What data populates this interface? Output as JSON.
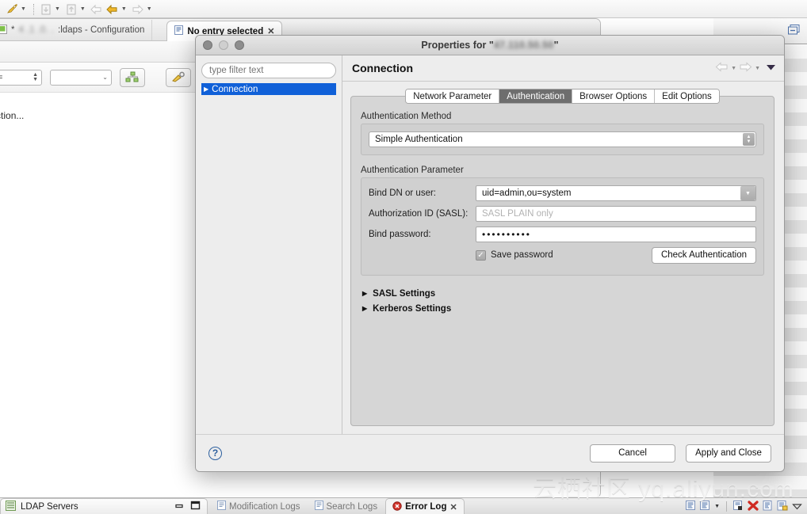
{
  "background": {
    "toolbar": {
      "icons": [
        "rocket-icon",
        "import-icon",
        "export-icon",
        "back-light-icon",
        "back-icon",
        "forward-icon"
      ]
    },
    "editor_tabs": [
      {
        "label_prefix": "*",
        "blurred": "4 .1 .0.   .  ",
        "label_suffix": ":ldaps - Configuration",
        "icon": "config-file-icon",
        "active": false
      },
      {
        "label": "No entry selected",
        "icon": "entry-icon",
        "active": true,
        "closable": true
      }
    ],
    "status_text": "nnection...",
    "editor_tool_icons": [
      "refresh-folder-icon",
      "sync-icon",
      "collapse-icon",
      "expand-arrows-icon"
    ],
    "filter_row": {
      "operator_value": "=",
      "value_value": ""
    },
    "bottom": {
      "left_panel_title": "LDAP Servers",
      "left_panel_icon": "ldap-servers-icon",
      "log_tabs": [
        {
          "label": "Modification Logs",
          "icon": "log-icon",
          "active": false
        },
        {
          "label": "Search Logs",
          "icon": "log-icon",
          "active": false
        },
        {
          "label": "Error Log",
          "icon": "error-log-icon",
          "active": true,
          "closable": true
        }
      ],
      "right_icons": [
        "log-view-icon",
        "log-view-2-icon",
        "delete-log-icon",
        "clear-error-icon",
        "details-icon",
        "export-log-icon",
        "view-menu-icon"
      ]
    }
  },
  "watermark": "云栖社区 yq.aliyun.com",
  "dialog": {
    "title_prefix": "Properties for \"",
    "title_blurred": "47.110.50.50",
    "title_suffix": "\"",
    "window_controls": [
      "close-button",
      "minimize-button",
      "zoom-button"
    ],
    "tree": {
      "filter_placeholder": "type filter text",
      "filter_value": "",
      "items": [
        {
          "label": "Connection",
          "selected": true,
          "expandable": true
        }
      ]
    },
    "page_title": "Connection",
    "nav": {
      "back_icon": "back-arrow-icon",
      "forward_icon": "forward-arrow-icon",
      "menu_icon": "view-menu-triangle-icon"
    },
    "tabs": [
      {
        "label": "Network Parameter",
        "active": false
      },
      {
        "label": "Authentication",
        "active": true
      },
      {
        "label": "Browser Options",
        "active": false
      },
      {
        "label": "Edit Options",
        "active": false
      }
    ],
    "authentication": {
      "method_group_label": "Authentication Method",
      "method_value": "Simple Authentication",
      "parameter_group_label": "Authentication Parameter",
      "fields": [
        {
          "label": "Bind DN or user:",
          "value": "uid=admin,ou=system",
          "type": "combo",
          "placeholder": ""
        },
        {
          "label": "Authorization ID (SASL):",
          "value": "",
          "type": "text",
          "placeholder": "SASL PLAIN only"
        },
        {
          "label": "Bind password:",
          "value": "••••••••••",
          "type": "password",
          "placeholder": ""
        }
      ],
      "save_password_label": "Save password",
      "save_password_checked": true,
      "check_authentication_label": "Check Authentication"
    },
    "expanders": [
      {
        "label": "SASL Settings",
        "expanded": false
      },
      {
        "label": "Kerberos Settings",
        "expanded": false
      }
    ],
    "footer": {
      "help_label": "?",
      "cancel_label": "Cancel",
      "apply_label": "Apply and Close"
    }
  }
}
